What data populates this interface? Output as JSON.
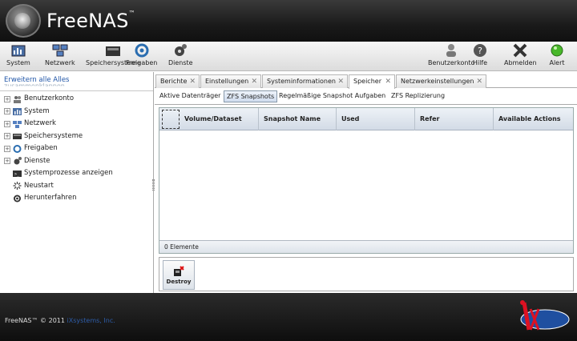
{
  "app": {
    "brand": "FreeNAS",
    "trademark": "™"
  },
  "toolbar": {
    "left": [
      {
        "label": "System",
        "icon": "system-icon"
      },
      {
        "label": "Netzwerk",
        "icon": "network-icon"
      },
      {
        "label": "Speichersysteme",
        "icon": "storage-icon"
      },
      {
        "label": "Freigaben",
        "icon": "shares-icon"
      },
      {
        "label": "Dienste",
        "icon": "services-icon"
      }
    ],
    "right": [
      {
        "label": "Benutzerkonto",
        "icon": "account-icon"
      },
      {
        "label": "Hilfe",
        "icon": "help-icon"
      },
      {
        "label": "Abmelden",
        "icon": "logout-icon"
      },
      {
        "label": "Alert",
        "icon": "alert-icon",
        "color": "#48b82a"
      }
    ]
  },
  "sidebar": {
    "expand_all": "Erweitern alle",
    "collapse_all": "Alles",
    "collapse_all_line2": "zusammenklappen",
    "items": [
      {
        "label": "Benutzerkonto",
        "expandable": true,
        "icon": "users-icon"
      },
      {
        "label": "System",
        "expandable": true,
        "icon": "system-icon"
      },
      {
        "label": "Netzwerk",
        "expandable": true,
        "icon": "network-icon"
      },
      {
        "label": "Speichersysteme",
        "expandable": true,
        "icon": "storage-icon"
      },
      {
        "label": "Freigaben",
        "expandable": true,
        "icon": "shares-icon"
      },
      {
        "label": "Dienste",
        "expandable": true,
        "icon": "services-icon"
      },
      {
        "label": "Systemprozesse anzeigen",
        "expandable": false,
        "icon": "terminal-icon"
      },
      {
        "label": "Neustart",
        "expandable": false,
        "icon": "restart-icon"
      },
      {
        "label": "Herunterfahren",
        "expandable": false,
        "icon": "power-icon"
      }
    ]
  },
  "tabs": [
    {
      "label": "Berichte",
      "active": false
    },
    {
      "label": "Einstellungen",
      "active": false
    },
    {
      "label": "Systeminformationen",
      "active": false
    },
    {
      "label": "Speicher",
      "active": true
    },
    {
      "label": "Netzwerkeinstellungen",
      "active": false
    }
  ],
  "subtabs": [
    {
      "label": "Aktive Datenträger",
      "active": false
    },
    {
      "label": "ZFS Snapshots",
      "active": true
    },
    {
      "label": "Regelmäßige Snapshot Aufgaben",
      "active": false
    },
    {
      "label": "ZFS Replizierung",
      "active": false
    }
  ],
  "grid": {
    "columns": [
      "Volume/Dataset",
      "Snapshot Name",
      "Used",
      "Refer",
      "Available Actions"
    ],
    "rows": [],
    "footer": "0 Elemente"
  },
  "actions": {
    "destroy_label": "Destroy"
  },
  "footer": {
    "copyright": "FreeNAS™ © 2011",
    "company": "iXsystems, Inc."
  },
  "colors": {
    "link": "#2257a8",
    "accent": "#2d5ca8"
  }
}
